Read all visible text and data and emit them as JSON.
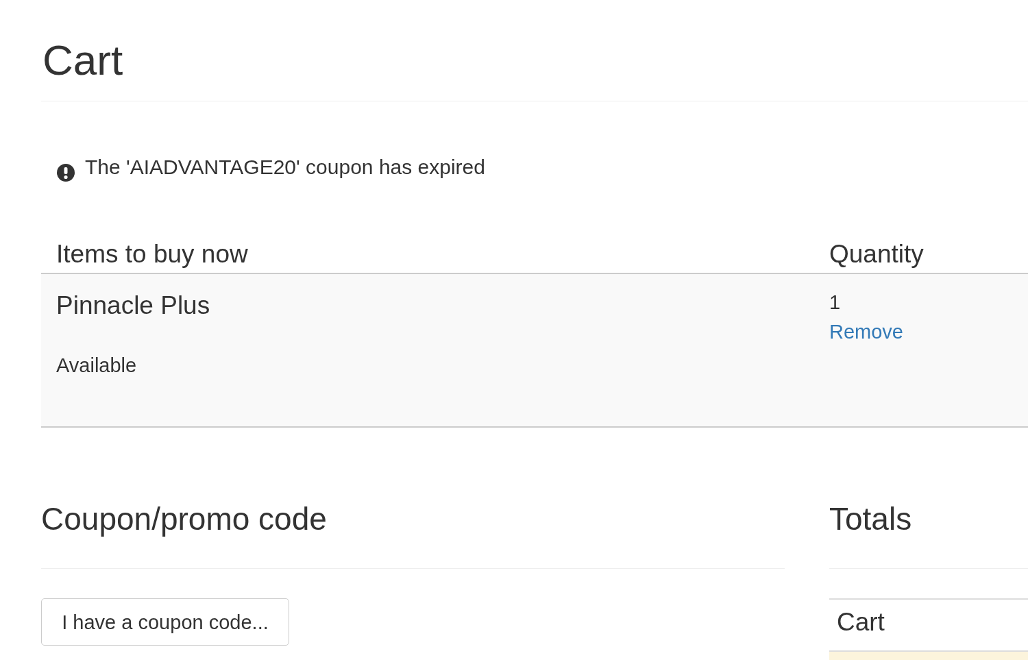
{
  "page": {
    "title": "Cart"
  },
  "alerts": [
    {
      "kind": "warning",
      "text": "The 'AIADVANTAGE20' coupon has expired"
    }
  ],
  "cart_table": {
    "columns": [
      "Items to buy now",
      "Quantity"
    ],
    "rows": [
      {
        "name": "Pinnacle Plus",
        "availability": "Available",
        "quantity": "1",
        "remove_link": "Remove"
      }
    ]
  },
  "coupon": {
    "title": "Coupon/promo code",
    "button": "I have a coupon code..."
  },
  "totals": {
    "title": "Totals",
    "rows": [
      {
        "label": "Cart",
        "highlighted": false
      },
      {
        "highlighted": true
      }
    ]
  }
}
